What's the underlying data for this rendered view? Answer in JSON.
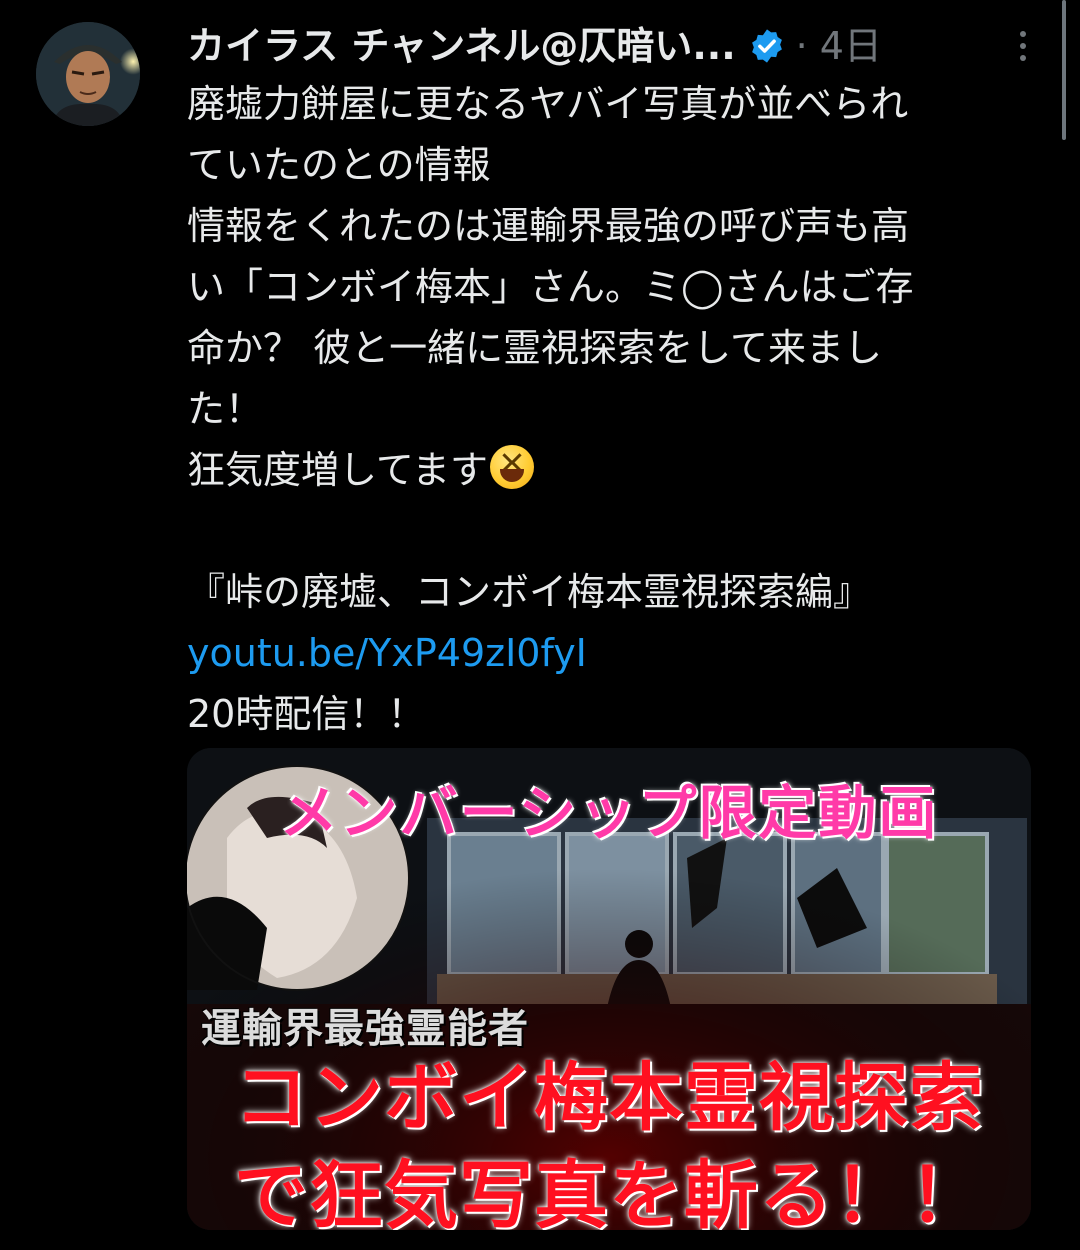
{
  "post": {
    "author_name": "カイラス チャンネル@仄暗い...",
    "meta": "· 4日",
    "verified_icon": "verified-badge-icon",
    "more_icon": "more-options-icon",
    "lines": [
      "廃墟力餅屋に更なるヤバイ写真が並べられ",
      "ていたのとの情報",
      "情報をくれたのは運輸界最強の呼び声も高",
      "い「コンボイ梅本」さん。ミ◯さんはご存",
      "命か？ 彼と一緒に霊視探索をして来まし",
      "た！"
    ],
    "line_emoji": "狂気度増してます",
    "emoji_name": "grinning-squinting-face-emoji",
    "video_title": "『峠の廃墟、コンボイ梅本霊視探索編』",
    "link": "youtu.be/YxP49zI0fyI",
    "stream_time": "20時配信！！"
  },
  "thumbnail": {
    "banner": "メンバーシップ限定動画",
    "caption_small": "運輸界最強霊能者",
    "caption_big_1": "コンボイ梅本霊視探索",
    "caption_big_2": "で狂気写真を斬る！！"
  },
  "colors": {
    "background": "#000000",
    "text": "#e7e9ea",
    "muted": "#71767b",
    "link": "#1d9bf0",
    "verified": "#1d9bf0",
    "banner_pink": "#ff3aa8",
    "caption_red": "#ff1020"
  }
}
